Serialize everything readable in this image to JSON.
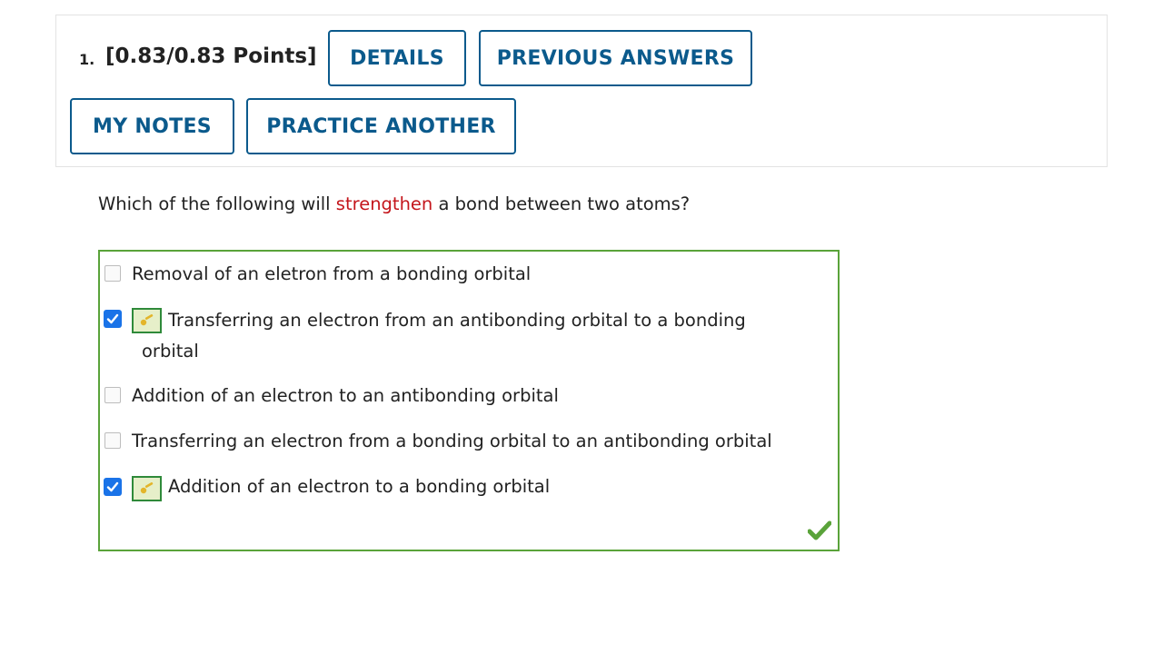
{
  "question": {
    "number": "1.",
    "points": "[0.83/0.83 Points]"
  },
  "buttons": {
    "details": "DETAILS",
    "previous_answers": "PREVIOUS ANSWERS",
    "my_notes": "MY NOTES",
    "practice_another": "PRACTICE ANOTHER"
  },
  "prompt": {
    "before": "Which of the following will ",
    "highlight": "strengthen",
    "after": " a bond between two atoms?"
  },
  "options": [
    {
      "text": "Removal of an eletron from a bonding orbital",
      "checked": false,
      "correct_key": false
    },
    {
      "line1": "Transferring an electron from an antibonding orbital to a bonding",
      "line2": "orbital",
      "checked": true,
      "correct_key": true
    },
    {
      "text": "Addition of an electron to an antibonding orbital",
      "checked": false,
      "correct_key": false
    },
    {
      "text": "Transferring an electron from a bonding orbital to an antibonding orbital",
      "checked": false,
      "correct_key": false
    },
    {
      "text": "Addition of an electron to a bonding orbital",
      "checked": true,
      "correct_key": true
    }
  ],
  "result": {
    "icon": "check-mark-icon",
    "status": "correct"
  },
  "colors": {
    "accent": "#0b5a8c",
    "highlight": "#c4161c",
    "correct_border": "#5aa33a",
    "checkbox": "#1a73e8"
  }
}
